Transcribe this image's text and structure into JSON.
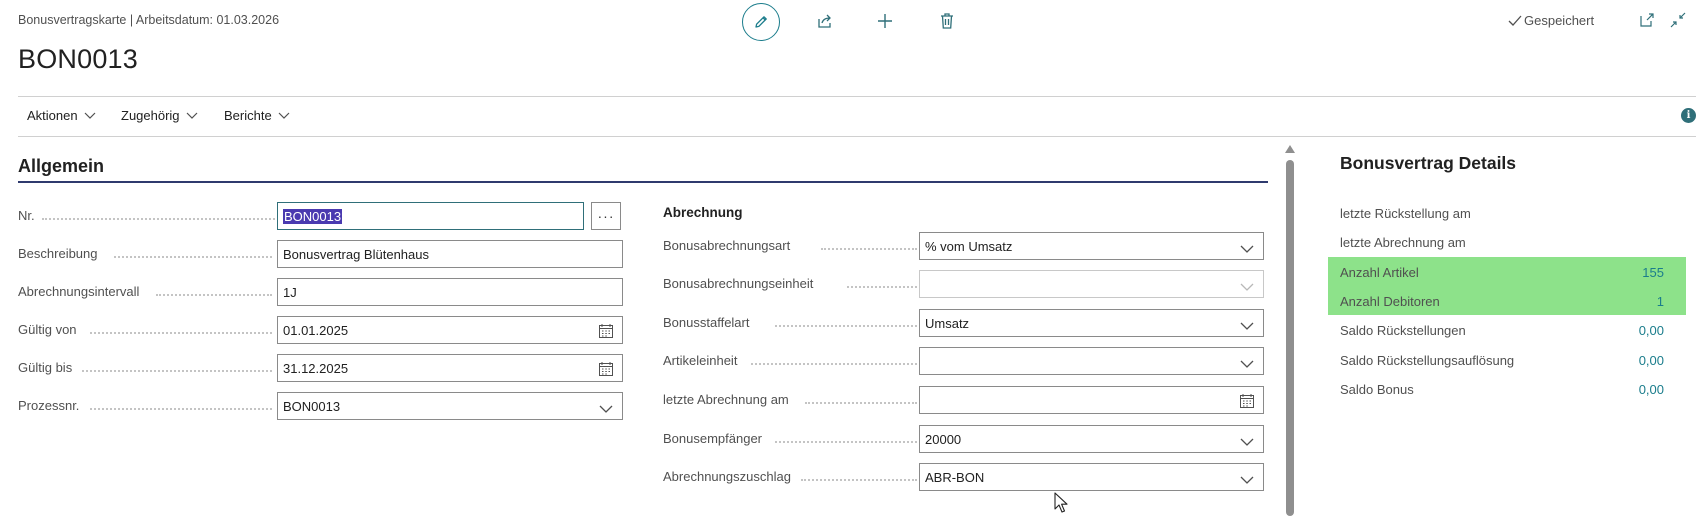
{
  "header": {
    "breadcrumb": "Bonusvertragskarte | Arbeitsdatum: 01.03.2026",
    "title": "BON0013",
    "saved_label": "Gespeichert"
  },
  "toolbar": {
    "icons": [
      "pencil-icon",
      "share-icon",
      "plus-icon",
      "trash-icon",
      "open-new-window-icon",
      "collapse-icon"
    ]
  },
  "menu": {
    "items": [
      "Aktionen",
      "Zugehörig",
      "Berichte"
    ]
  },
  "general": {
    "section_title": "Allgemein",
    "left_fields": [
      {
        "label": "Nr.",
        "value": "BON0013"
      },
      {
        "label": "Beschreibung",
        "value": "Bonusvertrag Blütenhaus"
      },
      {
        "label": "Abrechnungsintervall",
        "value": "1J"
      },
      {
        "label": "Gültig von",
        "value": "01.01.2025"
      },
      {
        "label": "Gültig bis",
        "value": "31.12.2025"
      },
      {
        "label": "Prozessnr.",
        "value": "BON0013"
      }
    ],
    "billing_heading": "Abrechnung",
    "right_fields": [
      {
        "label": "Bonusabrechnungsart",
        "value": "% vom Umsatz"
      },
      {
        "label": "Bonusabrechnungseinheit",
        "value": ""
      },
      {
        "label": "Bonusstaffelart",
        "value": "Umsatz"
      },
      {
        "label": "Artikeleinheit",
        "value": ""
      },
      {
        "label": "letzte Abrechnung am",
        "value": ""
      },
      {
        "label": "Bonusempfänger",
        "value": "20000"
      },
      {
        "label": "Abrechnungszuschlag",
        "value": "ABR-BON"
      }
    ]
  },
  "factbox": {
    "title": "Bonusvertrag Details",
    "rows": [
      {
        "label": "letzte Rückstellung am",
        "value": ""
      },
      {
        "label": "letzte Abrechnung am",
        "value": ""
      },
      {
        "label": "Anzahl Artikel",
        "value": "155"
      },
      {
        "label": "Anzahl Debitoren",
        "value": "1"
      },
      {
        "label": "Saldo Rückstellungen",
        "value": "0,00"
      },
      {
        "label": "Saldo Rückstellungsauflösung",
        "value": "0,00"
      },
      {
        "label": "Saldo Bonus",
        "value": "0,00"
      }
    ],
    "highlight_color": "#8de28a"
  },
  "colors": {
    "accent": "#1c7d8c",
    "section_underline": "#2f3a6e",
    "selection": "#4a3ab0"
  }
}
